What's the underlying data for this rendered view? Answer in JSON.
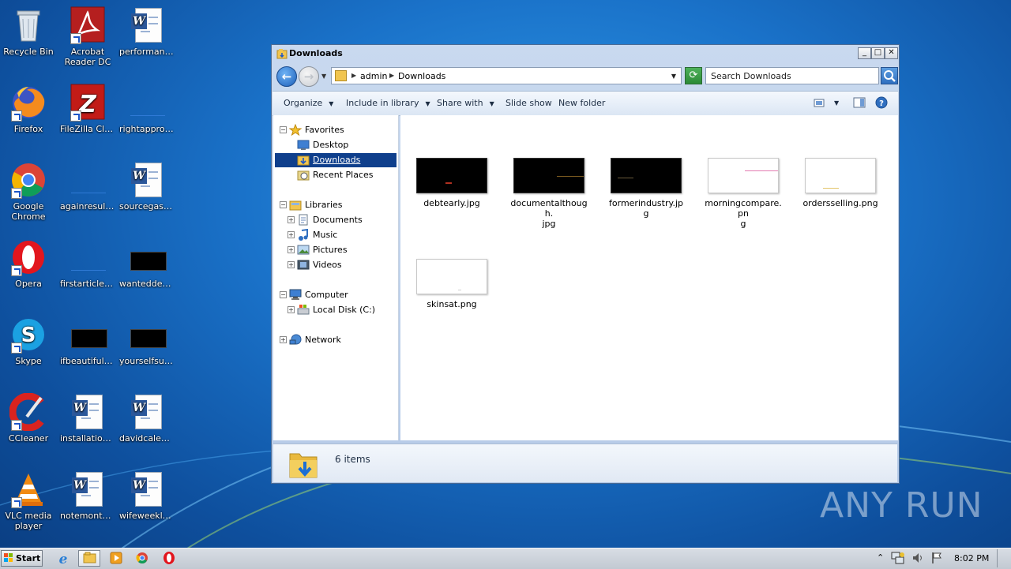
{
  "desktop": {
    "icons": [
      {
        "label": "Recycle Bin",
        "icon": "recycle-bin-icon"
      },
      {
        "label": "Acrobat Reader DC",
        "line1": "Acrobat",
        "line2": "Reader DC",
        "icon": "acrobat-reader-icon"
      },
      {
        "label": "performanc...",
        "icon": "word-document-icon"
      },
      {
        "label": "Firefox",
        "icon": "firefox-icon"
      },
      {
        "label": "FileZilla Client",
        "icon": "filezilla-icon"
      },
      {
        "label": "rightapproa...",
        "icon": "image-file-icon"
      },
      {
        "label": "Google Chrome",
        "line1": "Google",
        "line2": "Chrome",
        "icon": "chrome-icon"
      },
      {
        "label": "againresult....",
        "icon": "image-file-icon"
      },
      {
        "label": "sourcegas.rtf",
        "icon": "word-document-icon"
      },
      {
        "label": "Opera",
        "icon": "opera-icon"
      },
      {
        "label": "firstarticle.png",
        "icon": "image-file-icon"
      },
      {
        "label": "wanteddefi...",
        "icon": "image-file-icon"
      },
      {
        "label": "Skype",
        "icon": "skype-icon"
      },
      {
        "label": "ifbeautiful.jpg",
        "icon": "image-file-icon"
      },
      {
        "label": "yourselfsuit...",
        "icon": "image-file-icon"
      },
      {
        "label": "CCleaner",
        "icon": "ccleaner-icon"
      },
      {
        "label": "installationsi...",
        "icon": "word-document-icon"
      },
      {
        "label": "davidcalend...",
        "icon": "word-document-icon"
      },
      {
        "label": "VLC media player",
        "line1": "VLC media",
        "line2": "player",
        "icon": "vlc-icon"
      },
      {
        "label": "notemonthl...",
        "icon": "word-document-icon"
      },
      {
        "label": "wifeweekly.rtf",
        "icon": "word-document-icon"
      }
    ]
  },
  "window": {
    "title": "Downloads",
    "controls": {
      "minimize": "_",
      "maximize": "□",
      "close": "✕"
    },
    "address": {
      "crumbs": [
        "admin",
        "Downloads"
      ]
    },
    "search": {
      "placeholder": "Search Downloads"
    },
    "toolbar": {
      "organize": "Organize",
      "include_in_library": "Include in library",
      "share_with": "Share with",
      "slide_show": "Slide show",
      "new_folder": "New folder"
    },
    "nav": {
      "favorites": "Favorites",
      "desktop": "Desktop",
      "downloads": "Downloads",
      "recent_places": "Recent Places",
      "libraries": "Libraries",
      "documents": "Documents",
      "music": "Music",
      "pictures": "Pictures",
      "videos": "Videos",
      "computer": "Computer",
      "local_disk": "Local Disk (C:)",
      "network": "Network"
    },
    "files": [
      {
        "name": "debtearly.jpg",
        "thumb": "black",
        "mark": "#b03020"
      },
      {
        "name": "documentalthough.jpg",
        "line1": "documentalthough.",
        "line2": "jpg",
        "thumb": "black",
        "mark": "#7a5a20"
      },
      {
        "name": "formerindustry.jpg",
        "thumb": "black",
        "mark": "#6a5a3a"
      },
      {
        "name": "morningcompare.png",
        "line1": "morningcompare.pn",
        "line2": "g",
        "thumb": "white",
        "mark": "#e27ab0"
      },
      {
        "name": "ordersselling.png",
        "thumb": "white",
        "mark": "#e3c46a"
      },
      {
        "name": "skinsat.png",
        "thumb": "white",
        "mark": "#cfcfcf"
      }
    ],
    "status": "6 items"
  },
  "taskbar": {
    "start": "Start",
    "clock": "8:02 PM"
  },
  "watermark": "ANY RUN"
}
